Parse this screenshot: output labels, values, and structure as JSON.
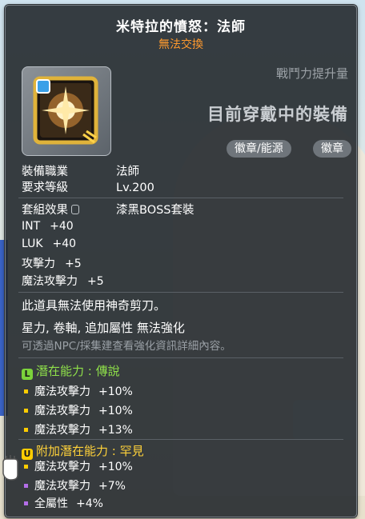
{
  "item": {
    "name": "米特拉的憤怒：法師",
    "trade_status": "無法交換",
    "combat_power_label": "戰鬥力提升量",
    "equipped_status": "目前穿戴中的裝備",
    "tags": [
      "徽章/能源",
      "徽章"
    ]
  },
  "requirements": {
    "job_label": "裝備職業",
    "job_value": "法師",
    "level_label": "要求等級",
    "level_value": "Lv.200"
  },
  "set": {
    "label": "套組效果",
    "value": "漆黑BOSS套裝"
  },
  "stats": [
    {
      "name": "INT",
      "value": "+40"
    },
    {
      "name": "LUK",
      "value": "+40"
    },
    {
      "name": "攻擊力",
      "value": "+5"
    },
    {
      "name": "魔法攻擊力",
      "value": "+5"
    }
  ],
  "notes": {
    "scissors": "此道具無法使用神奇剪刀。",
    "no_enhance": "星力, 卷軸, 追加屬性 無法強化",
    "hint": "可透過NPC/採集建查看強化資訊詳細內容。"
  },
  "potential": {
    "badge": "L",
    "title": "潛在能力 : 傳說",
    "lines": [
      {
        "name": "魔法攻擊力",
        "value": "+10%",
        "bullet": "yellow"
      },
      {
        "name": "魔法攻擊力",
        "value": "+10%",
        "bullet": "yellow"
      },
      {
        "name": "魔法攻擊力",
        "value": "+13%",
        "bullet": "yellow"
      }
    ]
  },
  "additional_potential": {
    "badge": "U",
    "title": "附加潛在能力 : 罕見",
    "lines": [
      {
        "name": "魔法攻擊力",
        "value": "+10%",
        "bullet": "yellow"
      },
      {
        "name": "魔法攻擊力",
        "value": "+7%",
        "bullet": "purple"
      },
      {
        "name": "全屬性",
        "value": "+4%",
        "bullet": "purple"
      }
    ]
  },
  "colors": {
    "trade_status": "#ff9a2e",
    "legendary": "#8fe04a",
    "unique": "#ffd23a",
    "bullet_yellow": "#ffcc00",
    "bullet_purple": "#b46ee8"
  }
}
